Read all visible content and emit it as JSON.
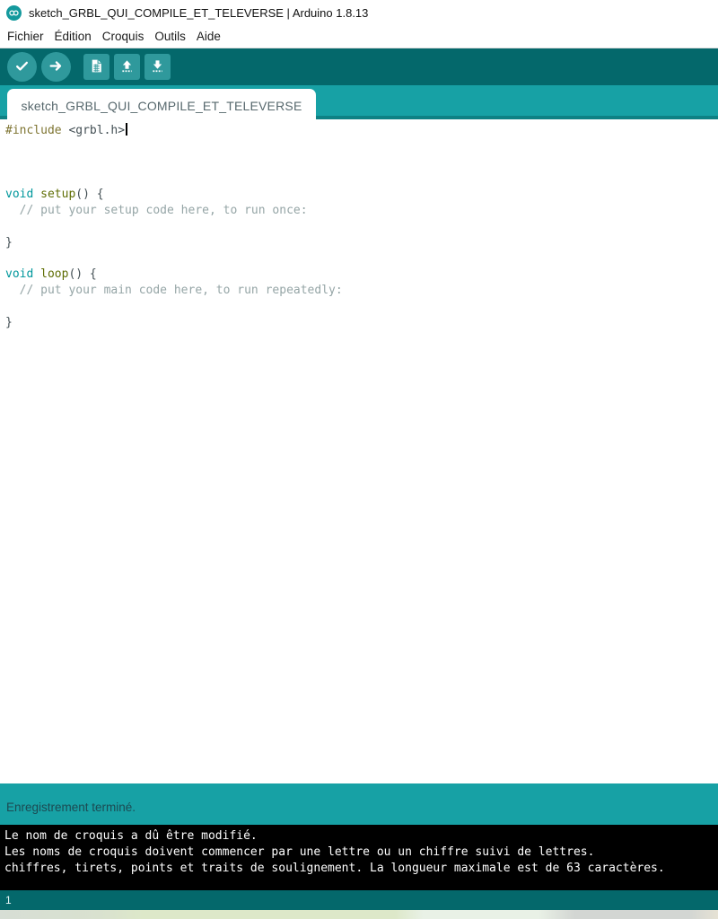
{
  "window": {
    "title": "sketch_GRBL_QUI_COMPILE_ET_TELEVERSE | Arduino 1.8.13",
    "app_icon": "arduino-infinity-logo"
  },
  "menu": {
    "items": [
      "Fichier",
      "Édition",
      "Croquis",
      "Outils",
      "Aide"
    ]
  },
  "toolbar": {
    "buttons": [
      {
        "name": "verify",
        "icon": "check-icon",
        "shape": "circle"
      },
      {
        "name": "upload",
        "icon": "arrow-right-icon",
        "shape": "circle"
      },
      {
        "name": "new-sketch",
        "icon": "document-icon",
        "shape": "square"
      },
      {
        "name": "open",
        "icon": "arrow-up-icon",
        "shape": "square"
      },
      {
        "name": "save",
        "icon": "arrow-down-icon",
        "shape": "square"
      }
    ]
  },
  "tabs": {
    "active_label": "sketch_GRBL_QUI_COMPILE_ET_TELEVERSE"
  },
  "editor": {
    "lines": [
      [
        {
          "c": "pre",
          "t": "#include"
        },
        {
          "c": "plain",
          "t": " <grbl.h>"
        },
        {
          "c": "caret",
          "t": ""
        }
      ],
      [],
      [],
      [],
      [
        {
          "c": "kw",
          "t": "void"
        },
        {
          "c": "plain",
          "t": " "
        },
        {
          "c": "fn",
          "t": "setup"
        },
        {
          "c": "plain",
          "t": "() {"
        }
      ],
      [
        {
          "c": "com",
          "t": "  // put your setup code here, to run once:"
        }
      ],
      [],
      [
        {
          "c": "plain",
          "t": "}"
        }
      ],
      [],
      [
        {
          "c": "kw",
          "t": "void"
        },
        {
          "c": "plain",
          "t": " "
        },
        {
          "c": "fn",
          "t": "loop"
        },
        {
          "c": "plain",
          "t": "() {"
        }
      ],
      [
        {
          "c": "com",
          "t": "  // put your main code here, to run repeatedly:"
        }
      ],
      [],
      [
        {
          "c": "plain",
          "t": "}"
        }
      ]
    ]
  },
  "status_bar": {
    "message": "Enregistrement terminé."
  },
  "console": {
    "lines": [
      "Le nom de croquis a dû être modifié.",
      "Les noms de croquis doivent commencer par une lettre ou un chiffre suivi de lettres.",
      "chiffres, tirets, points et traits de soulignement. La longueur maximale est de 63 caractères."
    ]
  },
  "footer": {
    "line_number": "1"
  },
  "colors": {
    "toolbar_teal_dark": "#04686b",
    "teal_light": "#17a1a5",
    "button_teal": "#2f999c",
    "tabstrip_border": "#0e8184",
    "syntax_preprocessor": "#7E7431",
    "syntax_keyword": "#00979C",
    "syntax_function": "#5E6D03",
    "syntax_comment": "#95A5A6",
    "syntax_plain": "#434f54",
    "console_bg": "#000000",
    "console_text": "#ffffff",
    "status_text": "#1c4a52"
  }
}
